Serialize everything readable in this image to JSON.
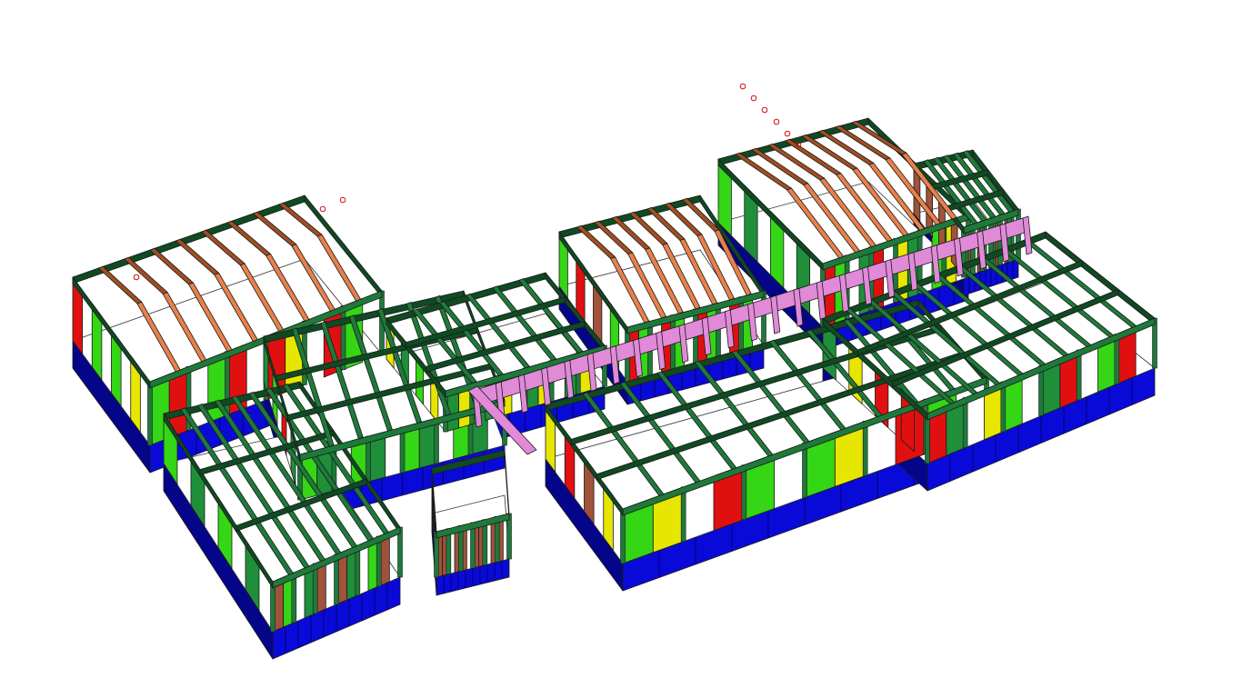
{
  "viewport": {
    "background": "#ffffff",
    "view": "3d-isometric-structural-model"
  },
  "palette": {
    "foundation": "#0a0ad8",
    "foundation_dark": "#05058a",
    "beam": "#1e7a3a",
    "beam_dark": "#0f4a22",
    "panel_light": "#35d615",
    "panel_mid": "#1f8f3a",
    "wall_red": "#e01010",
    "wall_yellow": "#e6e600",
    "wall_brown": "#a0523a",
    "rafter": "#e8804a",
    "rafter_dark": "#a04e22",
    "brace_pink": "#e08ad8",
    "edge": "#1a1a1a",
    "marker": "#d01010"
  },
  "markers_visible": true
}
